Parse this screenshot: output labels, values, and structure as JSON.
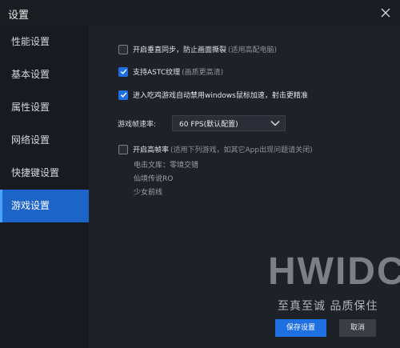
{
  "window": {
    "title": "设置"
  },
  "sidebar": {
    "items": [
      {
        "label": "性能设置",
        "active": false
      },
      {
        "label": "基本设置",
        "active": false
      },
      {
        "label": "属性设置",
        "active": false
      },
      {
        "label": "网络设置",
        "active": false
      },
      {
        "label": "快捷键设置",
        "active": false
      },
      {
        "label": "游戏设置",
        "active": true
      }
    ]
  },
  "settings": {
    "vsync": {
      "label": "开启垂直同步，防止画面撕裂",
      "note": "(适用高配电脑)",
      "checked": false
    },
    "astc": {
      "label": "支持ASTC纹理",
      "note": "(画质更高清)",
      "checked": true
    },
    "mouse_accel": {
      "label": "进入吃鸡游戏自动禁用windows鼠标加速，射击更精准",
      "checked": true
    },
    "fps": {
      "label": "游戏帧速率:",
      "value": "60 FPS(默认配置)"
    },
    "high_refresh": {
      "label": "开启高帧率",
      "note": "(适用下列游戏，如其它App出现问题请关闭)",
      "checked": false,
      "games": [
        "电击文库：零境交错",
        "仙境传说RO",
        "少女前线"
      ]
    }
  },
  "watermark": {
    "title": "HWIDC",
    "subtitle": "至真至诚 品质保住"
  },
  "buttons": {
    "save": "保存设置",
    "cancel": "取消"
  },
  "colors": {
    "accent": "#1e6fe0",
    "background": "#1e2128",
    "sidebar": "#181a1f",
    "active_item": "#1d64c9"
  }
}
